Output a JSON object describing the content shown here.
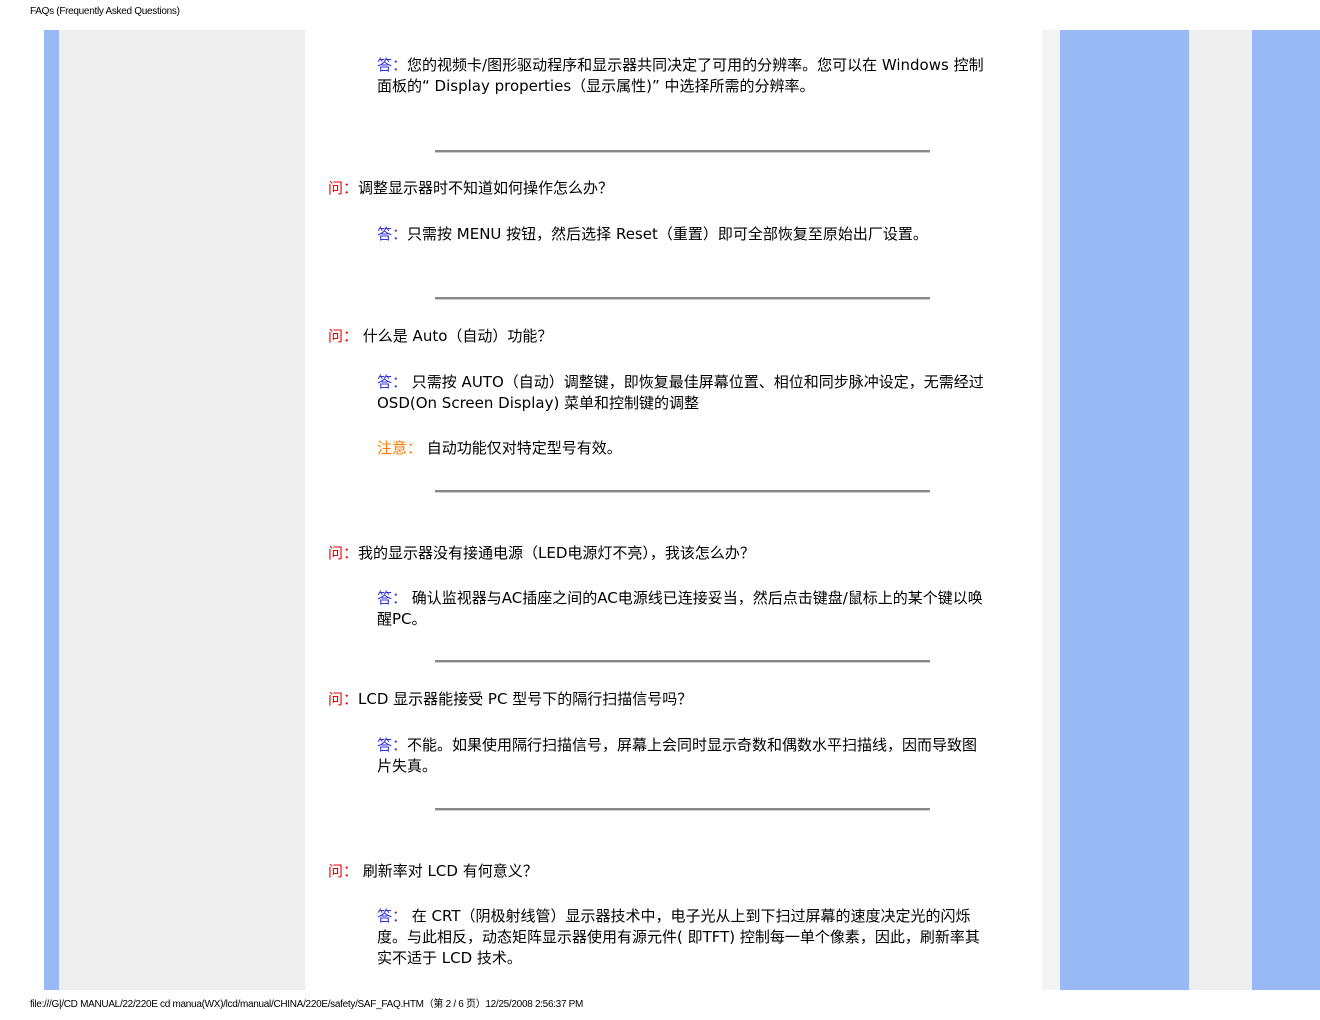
{
  "header": {
    "title": "FAQs (Frequently Asked Questions)"
  },
  "footer": {
    "path": "file:///G|/CD MANUAL/22/220E cd manua(WX)/lcd/manual/CHINA/220E/safety/SAF_FAQ.HTM（第 2 / 6 页）12/25/2008 2:56:37 PM"
  },
  "labels": {
    "q": "问：",
    "a": "答：",
    "note": "注意："
  },
  "faq": [
    {
      "answer": "您的视频卡/图形驱动程序和显示器共同决定了可用的分辨率。您可以在 Windows 控制面板的“ Display properties（显示属性)” 中选择所需的分辨率。"
    },
    {
      "question": "调整显示器时不知道如何操作怎么办？",
      "answer": "只需按 MENU 按钮，然后选择 Reset（重置）即可全部恢复至原始出厂设置。"
    },
    {
      "question": " 什么是 Auto（自动）功能？",
      "answer": " 只需按 AUTO（自动）调整键，即恢复最佳屏幕位置、相位和同步脉冲设定，无需经过OSD(On Screen Display) 菜单和控制键的调整",
      "note": " 自动功能仅对特定型号有效。"
    },
    {
      "question": "我的显示器没有接通电源（LED电源灯不亮），我该怎么办？",
      "answer": " 确认监视器与AC插座之间的AC电源线已连接妥当，然后点击键盘/鼠标上的某个键以唤醒PC。"
    },
    {
      "question": "LCD 显示器能接受 PC 型号下的隔行扫描信号吗？",
      "answer": "不能。如果使用隔行扫描信号，屏幕上会同时显示奇数和偶数水平扫描线，因而导致图片失真。"
    },
    {
      "question": " 刷新率对 LCD 有何意义？",
      "answer": " 在 CRT（阴极射线管）显示器技术中，电子光从上到下扫过屏幕的速度决定光的闪烁度。与此相反，动态矩阵显示器使用有源元件( 即TFT) 控制每一单个像素，因此，刷新率其实不适于 LCD 技术。"
    }
  ]
}
